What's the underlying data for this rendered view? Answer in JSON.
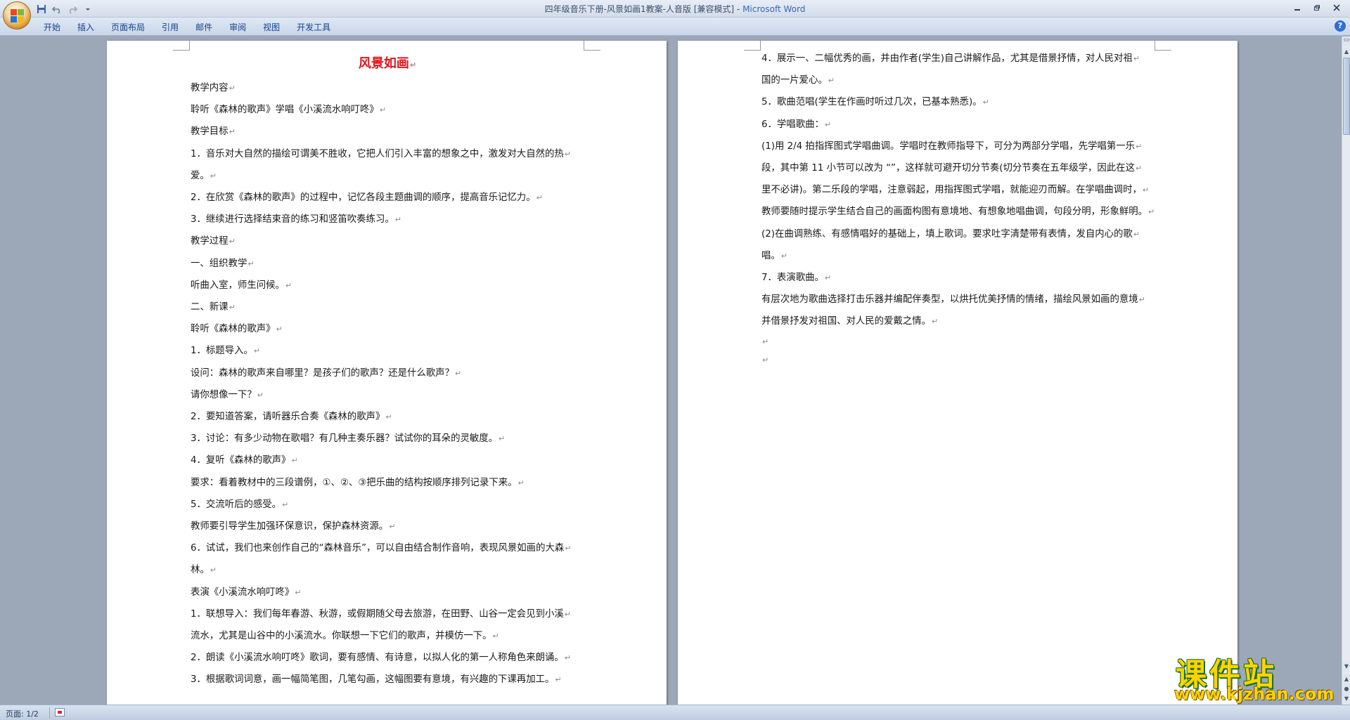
{
  "window": {
    "title_doc": "四年级音乐下册-风景如画1教案-人音版 [兼容模式] - ",
    "title_app": "Microsoft Word"
  },
  "qat": {
    "save_icon": "save-icon",
    "undo_icon": "undo-icon",
    "redo_icon": "redo-icon",
    "customize_icon": "qat-dropdown-icon"
  },
  "ribbon": {
    "tabs": [
      "开始",
      "插入",
      "页面布局",
      "引用",
      "邮件",
      "审阅",
      "视图",
      "开发工具"
    ],
    "help_label": "?"
  },
  "page1": {
    "title": "风景如画",
    "paragraphs": [
      "教学内容",
      "聆听《森林的歌声》学唱《小溪流水响叮咚》",
      "教学目标",
      "1．音乐对大自然的描绘可谓美不胜收，它把人们引入丰富的想象之中，激发对大自然的热",
      "爱。",
      "2．在欣赏《森林的歌声》的过程中，记忆各段主题曲调的顺序，提高音乐记忆力。",
      "3．继续进行选择结束音的练习和竖笛吹奏练习。",
      "教学过程",
      "一、组织教学",
      "听曲入室，师生问候。",
      "二、新课",
      "聆听《森林的歌声》",
      "1．标题导入。",
      "设问：森林的歌声来自哪里？是孩子们的歌声？还是什么歌声？",
      "请你想像一下？",
      "2．要知道答案，请听器乐合奏《森林的歌声》",
      "3．讨论：有多少动物在歌唱？有几种主奏乐器？试试你的耳朵的灵敏度。",
      "4．复听《森林的歌声》",
      "要求：看着教材中的三段谱例，①、②、③把乐曲的结构按顺序排列记录下来。",
      "5．交流听后的感受。",
      "教师要引导学生加强环保意识，保护森林资源。",
      "6．试试，我们也来创作自己的“森林音乐”，可以自由结合制作音响，表现风景如画的大森",
      "林。",
      "表演《小溪流水响叮咚》",
      "1．联想导入：我们每年春游、秋游，或假期随父母去旅游，在田野、山谷一定会见到小溪",
      "流水，尤其是山谷中的小溪流水。你联想一下它们的歌声，并模仿一下。",
      "2．朗读《小溪流水响叮咚》歌词，要有感情、有诗意，以拟人化的第一人称角色来朗诵。",
      "3．根据歌词词意，画一幅简笔图，几笔勾画，这幅图要有意境，有兴趣的下课再加工。"
    ]
  },
  "page2": {
    "paragraphs": [
      "4．展示一、二幅优秀的画，并由作者(学生)自己讲解作品，尤其是借景抒情，对人民对祖",
      "国的一片爱心。",
      "5．歌曲范唱(学生在作画时听过几次，已基本熟悉)。",
      "6．学唱歌曲：",
      "(1)用 2/4 拍指挥图式学唱曲调。学唱时在教师指导下，可分为两部分学唱，先学唱第一乐",
      "段，其中第 11 小节可以改为 “”，这样就可避开切分节奏(切分节奏在五年级学，因此在这",
      "里不必讲)。第二乐段的学唱，注意弱起，用指挥图式学唱，就能迎刃而解。在学唱曲调时，",
      "教师要随时提示学生结合自己的画面构图有意境地、有想象地唱曲调，句段分明，形象鲜明。",
      "(2)在曲调熟练、有感情唱好的基础上，填上歌词。要求吐字清楚带有表情，发自内心的歌",
      "唱。",
      "7．表演歌曲。",
      "有层次地为歌曲选择打击乐器并编配伴奏型，以烘托优美抒情的情绪，描绘风景如画的意境",
      "并借景抒发对祖国、对人民的爱戴之情。",
      "",
      ""
    ]
  },
  "statusbar": {
    "page_indicator": "页面: 1/2"
  },
  "watermark": {
    "text": "课件站",
    "url": "www.kjzhan.com"
  },
  "paragraph_mark": "↵",
  "colors": {
    "title_red": "#e0161d",
    "watermark_yellow": "#ffd400",
    "workspace": "#9ca8b8"
  }
}
